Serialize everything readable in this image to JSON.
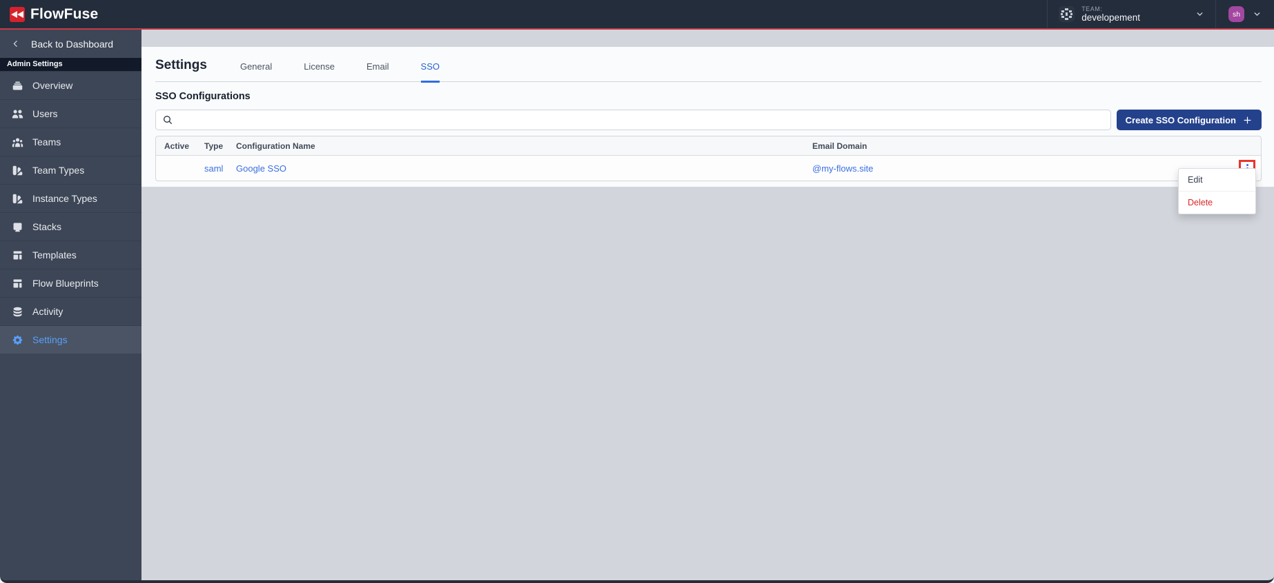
{
  "topbar": {
    "brand": "FlowFuse",
    "team_label": "TEAM:",
    "team_name": "developement",
    "avatar_initials": "sh"
  },
  "sidebar": {
    "back_label": "Back to Dashboard",
    "section_label": "Admin Settings",
    "items": [
      {
        "label": "Overview",
        "icon": "overview-icon",
        "active": false
      },
      {
        "label": "Users",
        "icon": "users-icon",
        "active": false
      },
      {
        "label": "Teams",
        "icon": "teams-icon",
        "active": false
      },
      {
        "label": "Team Types",
        "icon": "team-types-icon",
        "active": false
      },
      {
        "label": "Instance Types",
        "icon": "instance-types-icon",
        "active": false
      },
      {
        "label": "Stacks",
        "icon": "stacks-icon",
        "active": false
      },
      {
        "label": "Templates",
        "icon": "templates-icon",
        "active": false
      },
      {
        "label": "Flow Blueprints",
        "icon": "flow-blueprints-icon",
        "active": false
      },
      {
        "label": "Activity",
        "icon": "activity-icon",
        "active": false
      },
      {
        "label": "Settings",
        "icon": "settings-icon",
        "active": true
      }
    ]
  },
  "main": {
    "title": "Settings",
    "tabs": [
      {
        "label": "General",
        "active": false
      },
      {
        "label": "License",
        "active": false
      },
      {
        "label": "Email",
        "active": false
      },
      {
        "label": "SSO",
        "active": true
      }
    ],
    "section_title": "SSO Configurations",
    "search": {
      "value": "",
      "placeholder": ""
    },
    "create_button_label": "Create SSO Configuration",
    "table": {
      "headers": {
        "active": "Active",
        "type": "Type",
        "name": "Configuration Name",
        "email_domain": "Email Domain"
      },
      "rows": [
        {
          "active": "",
          "type": "saml",
          "name": "Google SSO",
          "email_domain": "@my-flows.site"
        }
      ]
    },
    "context_menu": {
      "items": [
        {
          "label": "Edit",
          "danger": false
        },
        {
          "label": "Delete",
          "danger": true
        }
      ]
    }
  },
  "colors": {
    "topbar_bg": "#232d3c",
    "accent_red_line": "#c93944",
    "brand_red": "#d5222b",
    "sidebar_bg": "#3d4656",
    "sidebar_active_bg": "#4a5464",
    "highlight_blue": "#5a9ff8",
    "tab_active_blue": "#2462d9",
    "link_blue": "#3a6fe0",
    "button_navy": "#24418c",
    "danger_red": "#dc2626",
    "annotation_red_box": "#e8362e",
    "avatar_purple": "#a347a0",
    "content_gray": "#d2d5dc"
  }
}
